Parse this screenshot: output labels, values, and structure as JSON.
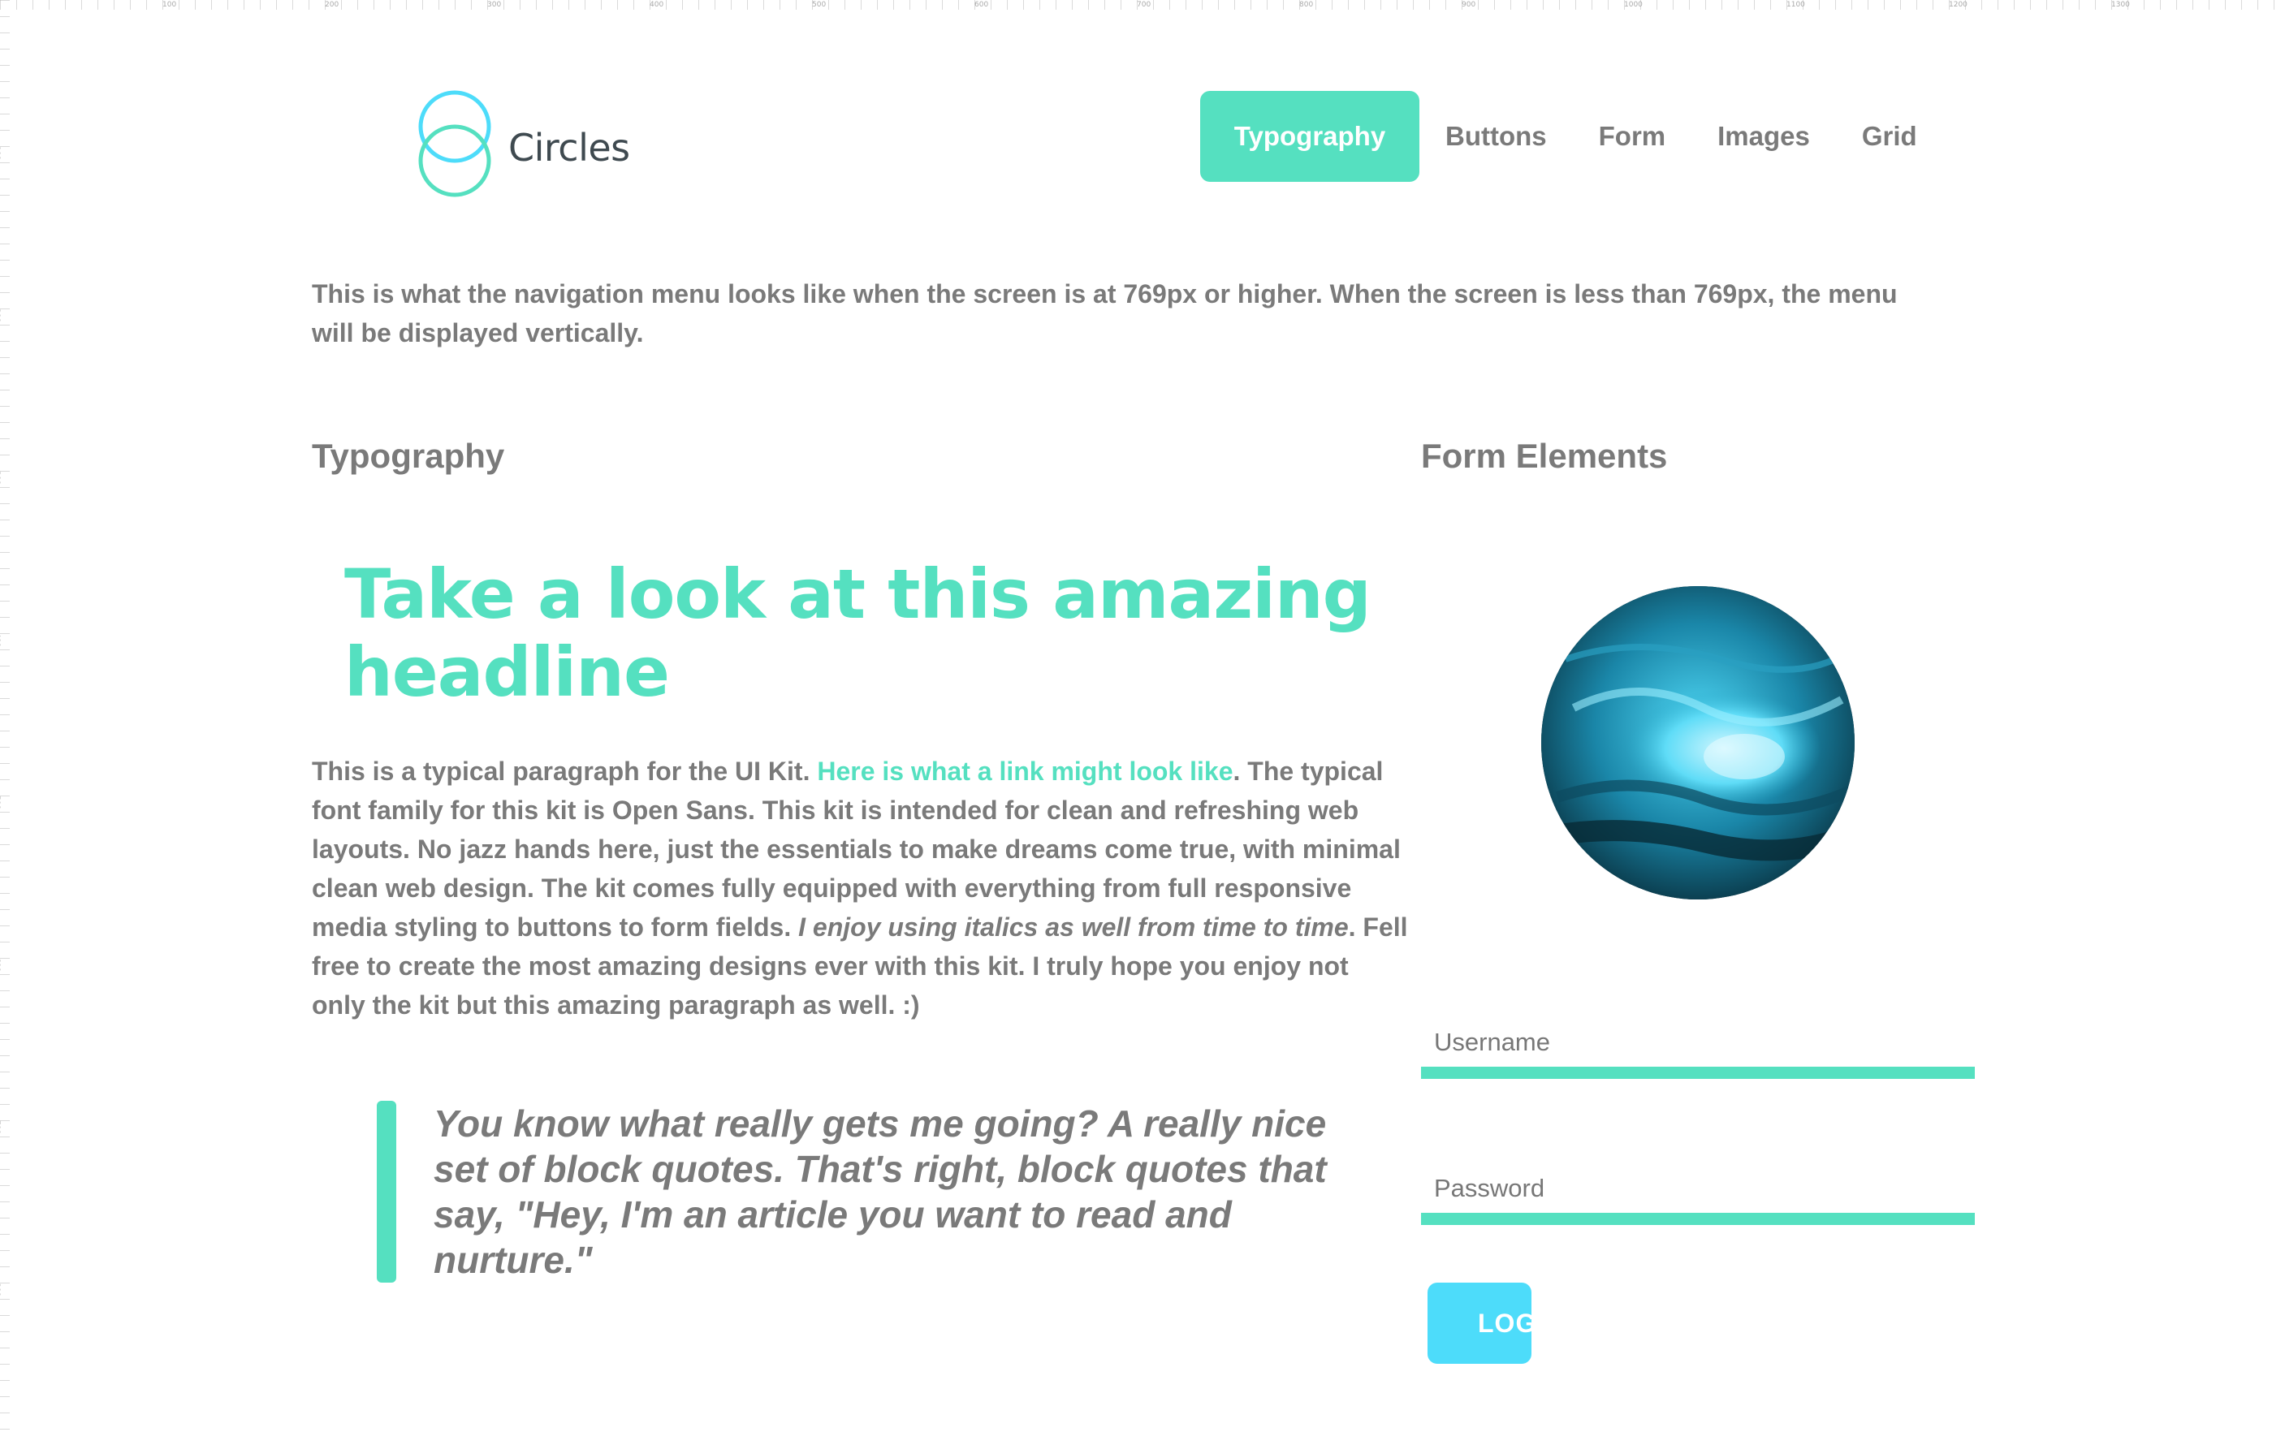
{
  "ruler": {
    "x_ticks": [
      "100",
      "200",
      "300",
      "400",
      "500",
      "600",
      "700",
      "800",
      "900",
      "1000",
      "1100",
      "1200",
      "1300"
    ],
    "y_ticks": [
      "100",
      "200",
      "300",
      "400",
      "500",
      "600",
      "700",
      "800"
    ]
  },
  "brand": {
    "name": "Circles",
    "icon": "overlapping-circles-logo",
    "color_top_ring": "#4ddcfa",
    "color_bottom_ring": "#55e0c0"
  },
  "nav": {
    "items": [
      {
        "label": "Typography",
        "active": true
      },
      {
        "label": "Buttons",
        "active": false
      },
      {
        "label": "Form",
        "active": false
      },
      {
        "label": "Images",
        "active": false
      },
      {
        "label": "Grid",
        "active": false
      }
    ]
  },
  "intro": {
    "text": "This is what the navigation menu looks like when the screen is at 769px or higher. When the screen is less than 769px, the menu will be displayed vertically."
  },
  "typography": {
    "heading": "Typography",
    "headline": "Take a look at this amazing headline",
    "paragraph": {
      "part1": "This is a typical paragraph for the UI Kit. ",
      "link": "Here is what a link might look like",
      "part2": ". The typical font family for this kit is Open Sans. This kit is intended for clean and refreshing web layouts. No jazz hands here, just the essentials to make dreams come true, with minimal clean web design. The kit comes fully equipped with everything from full responsive media styling to buttons to form fields. ",
      "italic": "I enjoy using italics as well from time to time",
      "part3": ". Fell free to create the most amazing designs ever with this kit. I truly hope you enjoy not only the kit but this amazing paragraph as well. :)"
    },
    "blockquote": "You know what really gets me going? A really nice set of block quotes. That's right, block quotes that say, \"Hey, I'm an article you want to read and nurture.\""
  },
  "form": {
    "heading": "Form Elements",
    "avatar_icon": "ocean-wave-image",
    "username_placeholder": "Username",
    "password_placeholder": "Password",
    "login_label": "LOGIN"
  },
  "colors": {
    "accent": "#55e0c0",
    "accent_blue": "#4ddcfa",
    "text": "#7a7a7a"
  }
}
